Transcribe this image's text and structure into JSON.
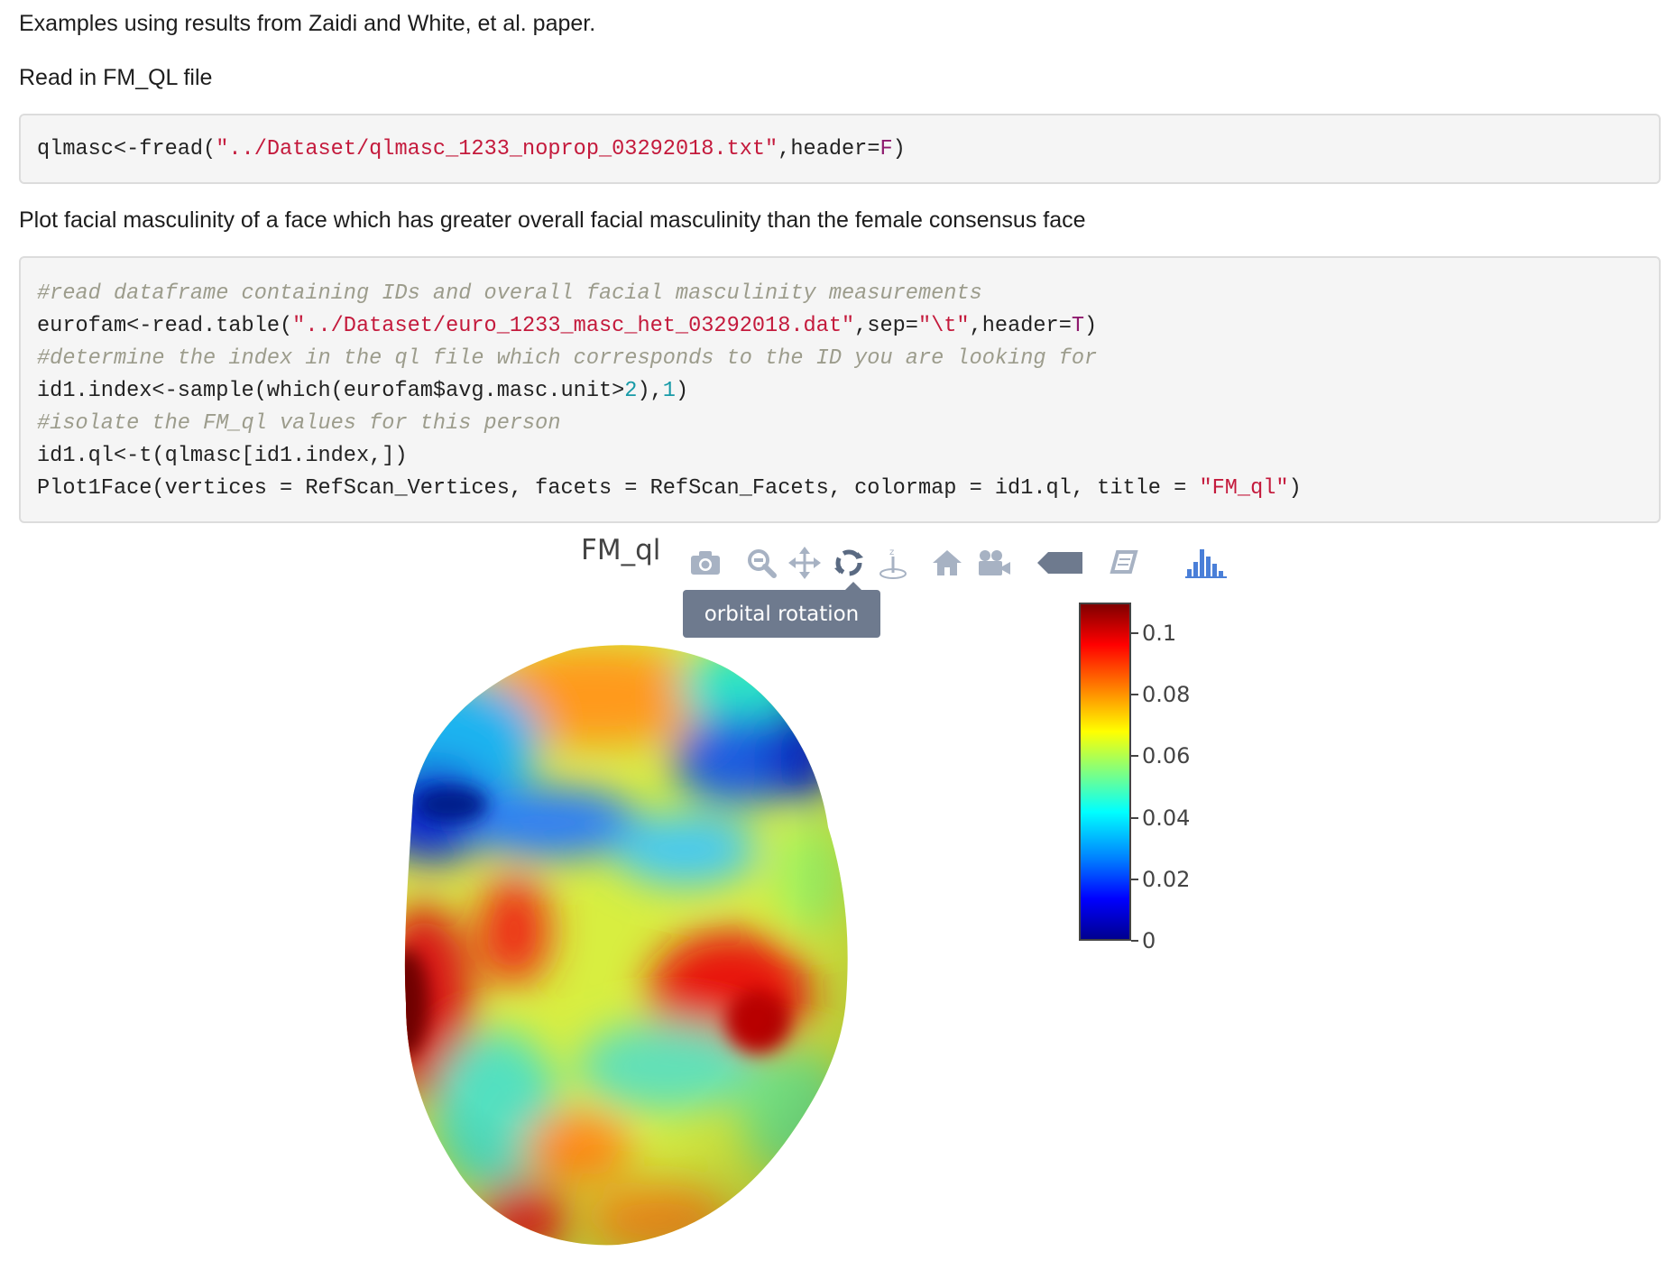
{
  "intro_text": "Examples using results from Zaidi and White, et al. paper.",
  "read_heading": "Read in FM_QL file",
  "code1": {
    "lines": [
      [
        {
          "t": "qlmasc<-fread(",
          "c": ""
        },
        {
          "t": "\"../Dataset/qlmasc_1233_noprop_03292018.txt\"",
          "c": "str"
        },
        {
          "t": ",header=",
          "c": ""
        },
        {
          "t": "F",
          "c": "kw"
        },
        {
          "t": ")",
          "c": ""
        }
      ]
    ]
  },
  "plot_heading": "Plot facial masculinity of a face which has greater overall facial masculinity than the female consensus face",
  "code2": {
    "lines": [
      [
        {
          "t": "#read dataframe containing IDs and overall facial masculinity measurements",
          "c": "cmt"
        }
      ],
      [
        {
          "t": "eurofam<-read.table(",
          "c": ""
        },
        {
          "t": "\"../Dataset/euro_1233_masc_het_03292018.dat\"",
          "c": "str"
        },
        {
          "t": ",sep=",
          "c": ""
        },
        {
          "t": "\"\\t\"",
          "c": "str"
        },
        {
          "t": ",header=",
          "c": ""
        },
        {
          "t": "T",
          "c": "kw"
        },
        {
          "t": ")",
          "c": ""
        }
      ],
      [
        {
          "t": "#determine the index in the ql file which corresponds to the ID you are looking for",
          "c": "cmt"
        }
      ],
      [
        {
          "t": "id1.index<-sample(which(eurofam$avg.masc.unit>",
          "c": ""
        },
        {
          "t": "2",
          "c": "num"
        },
        {
          "t": "),",
          "c": ""
        },
        {
          "t": "1",
          "c": "num"
        },
        {
          "t": ")",
          "c": ""
        }
      ],
      [
        {
          "t": "#isolate the FM_ql values for this person",
          "c": "cmt"
        }
      ],
      [
        {
          "t": "id1.ql<-t(qlmasc[id1.index,])",
          "c": ""
        }
      ],
      [
        {
          "t": "Plot1Face(vertices = RefScan_Vertices, facets = RefScan_Facets, colormap = id1.ql, title = ",
          "c": ""
        },
        {
          "t": "\"FM_ql\"",
          "c": "str"
        },
        {
          "t": ")",
          "c": ""
        }
      ]
    ]
  },
  "plot": {
    "title": "FM_ql",
    "tooltip": "orbital rotation",
    "toolbar": [
      {
        "name": "camera-icon"
      },
      {
        "name": "zoom-icon"
      },
      {
        "name": "pan-icon"
      },
      {
        "name": "orbital-rotation-icon"
      },
      {
        "name": "turntable-rotation-icon"
      },
      {
        "name": "home-icon"
      },
      {
        "name": "video-camera-icon"
      },
      {
        "name": "hover-tag-icon"
      },
      {
        "name": "spikelines-icon"
      },
      {
        "name": "plotly-logo-icon"
      }
    ],
    "colorbar": {
      "ticks": [
        "0.1",
        "0.08",
        "0.06",
        "0.04",
        "0.02",
        "0"
      ],
      "range": [
        0,
        0.11
      ],
      "colorscale": [
        "#00008f",
        "#0000ff",
        "#00ffff",
        "#ffff00",
        "#ff0000",
        "#800000"
      ]
    }
  }
}
